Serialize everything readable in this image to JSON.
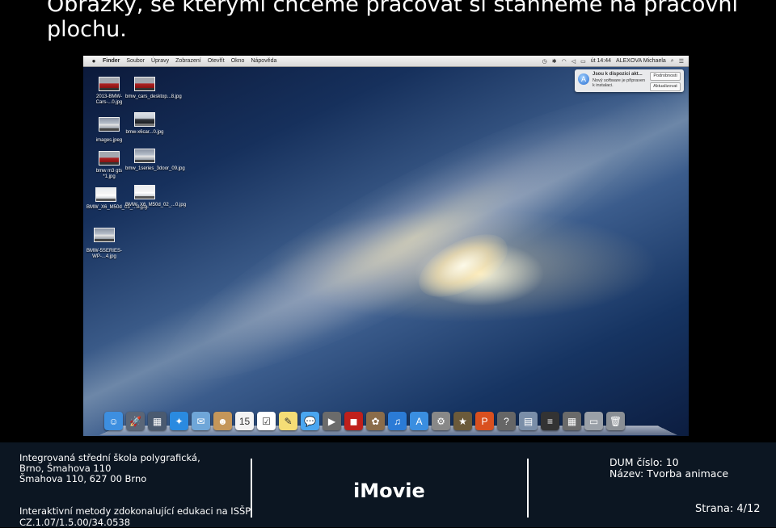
{
  "slide": {
    "title": "Obrázky, se kterými chceme pracovat si stáhneme na pracovní plochu."
  },
  "menubar": {
    "apple_icon": "apple-icon",
    "items": [
      "Finder",
      "Soubor",
      "Úpravy",
      "Zobrazení",
      "Otevřít",
      "Okno",
      "Nápověda"
    ],
    "clock": "út 14:44",
    "user": "ALEXOVA Michaela"
  },
  "notification": {
    "title": "Jsou k dispozici akt...",
    "text": "Nový software je připraven k instalaci.",
    "button_details": "Podrobnosti",
    "button_update": "Aktualizovat"
  },
  "desktop_icons": [
    {
      "label": "2013-BMW-Cars-...0.jpg",
      "style": "red"
    },
    {
      "label": "bmw_cars_desktop...8.jpg",
      "style": "red"
    },
    {
      "label": "images.jpeg",
      "style": "silver"
    },
    {
      "label": "bmw-x6car...0.jpg",
      "style": "dark"
    },
    {
      "label": "bmw m3 gts *1.jpg",
      "style": "red"
    },
    {
      "label": "bmw_1series_3door_09.jpg",
      "style": "silver"
    },
    {
      "label": "BMW_X6_M50d_03_...0.jpg",
      "style": "white"
    },
    {
      "label": "BMW_X6_M50d_02_...0.jpg",
      "style": "white"
    },
    {
      "label": "BMW-5SERIES-WP-...4.jpg",
      "style": "silver"
    }
  ],
  "dock": {
    "icons": [
      {
        "name": "finder-icon",
        "glyph": "☺",
        "color": "#3d8fe0"
      },
      {
        "name": "launchpad-icon",
        "glyph": "🚀",
        "color": "#5a6678"
      },
      {
        "name": "mission-control-icon",
        "glyph": "▦",
        "color": "#4a5a70"
      },
      {
        "name": "safari-icon",
        "glyph": "✦",
        "color": "#2a8ae0"
      },
      {
        "name": "mail-icon",
        "glyph": "✉",
        "color": "#6fa6d8"
      },
      {
        "name": "contacts-icon",
        "glyph": "☻",
        "color": "#c4965a"
      },
      {
        "name": "calendar-icon",
        "glyph": "15",
        "color": "#f3f3f3"
      },
      {
        "name": "reminders-icon",
        "glyph": "☑",
        "color": "#ffffff"
      },
      {
        "name": "notes-icon",
        "glyph": "✎",
        "color": "#f5dd76"
      },
      {
        "name": "messages-icon",
        "glyph": "💬",
        "color": "#4aa6f0"
      },
      {
        "name": "facetime-icon",
        "glyph": "▶",
        "color": "#6b6b6b"
      },
      {
        "name": "photo-booth-icon",
        "glyph": "◼",
        "color": "#c0201c"
      },
      {
        "name": "iphoto-icon",
        "glyph": "✿",
        "color": "#8a6c4a"
      },
      {
        "name": "itunes-icon",
        "glyph": "♫",
        "color": "#2b7bd6"
      },
      {
        "name": "app-store-icon",
        "glyph": "A",
        "color": "#3a8ee0"
      },
      {
        "name": "system-preferences-icon",
        "glyph": "⚙",
        "color": "#888"
      },
      {
        "name": "imovie-icon",
        "glyph": "★",
        "color": "#6b5a3a"
      },
      {
        "name": "powerpoint-icon",
        "glyph": "P",
        "color": "#d9501f"
      },
      {
        "name": "help-icon",
        "glyph": "?",
        "color": "#666"
      },
      {
        "name": "preview-icon",
        "glyph": "▤",
        "color": "#7a8ea8"
      },
      {
        "name": "terminal-icon",
        "glyph": "≡",
        "color": "#333"
      },
      {
        "name": "downloads-stack-icon",
        "glyph": "▦",
        "color": "#6a6a6a"
      },
      {
        "name": "documents-stack-icon",
        "glyph": "▭",
        "color": "#9aa0a8"
      },
      {
        "name": "trash-icon",
        "glyph": "🗑",
        "color": "#8a8f95"
      }
    ]
  },
  "footer": {
    "school_line1": "Integrovaná střední škola polygrafická,",
    "school_line2": "Brno, Šmahova 110",
    "school_line3": "Šmahova 110, 627 00 Brno",
    "project_line1": "Interaktivní metody zdokonalující edukaci na ISŠP",
    "project_line2": "CZ.1.07/1.5.00/34.0538",
    "center_title": "iMovie",
    "dum": "DUM číslo: 10",
    "name": "Název: Tvorba animace",
    "page": "Strana: 4/12"
  }
}
